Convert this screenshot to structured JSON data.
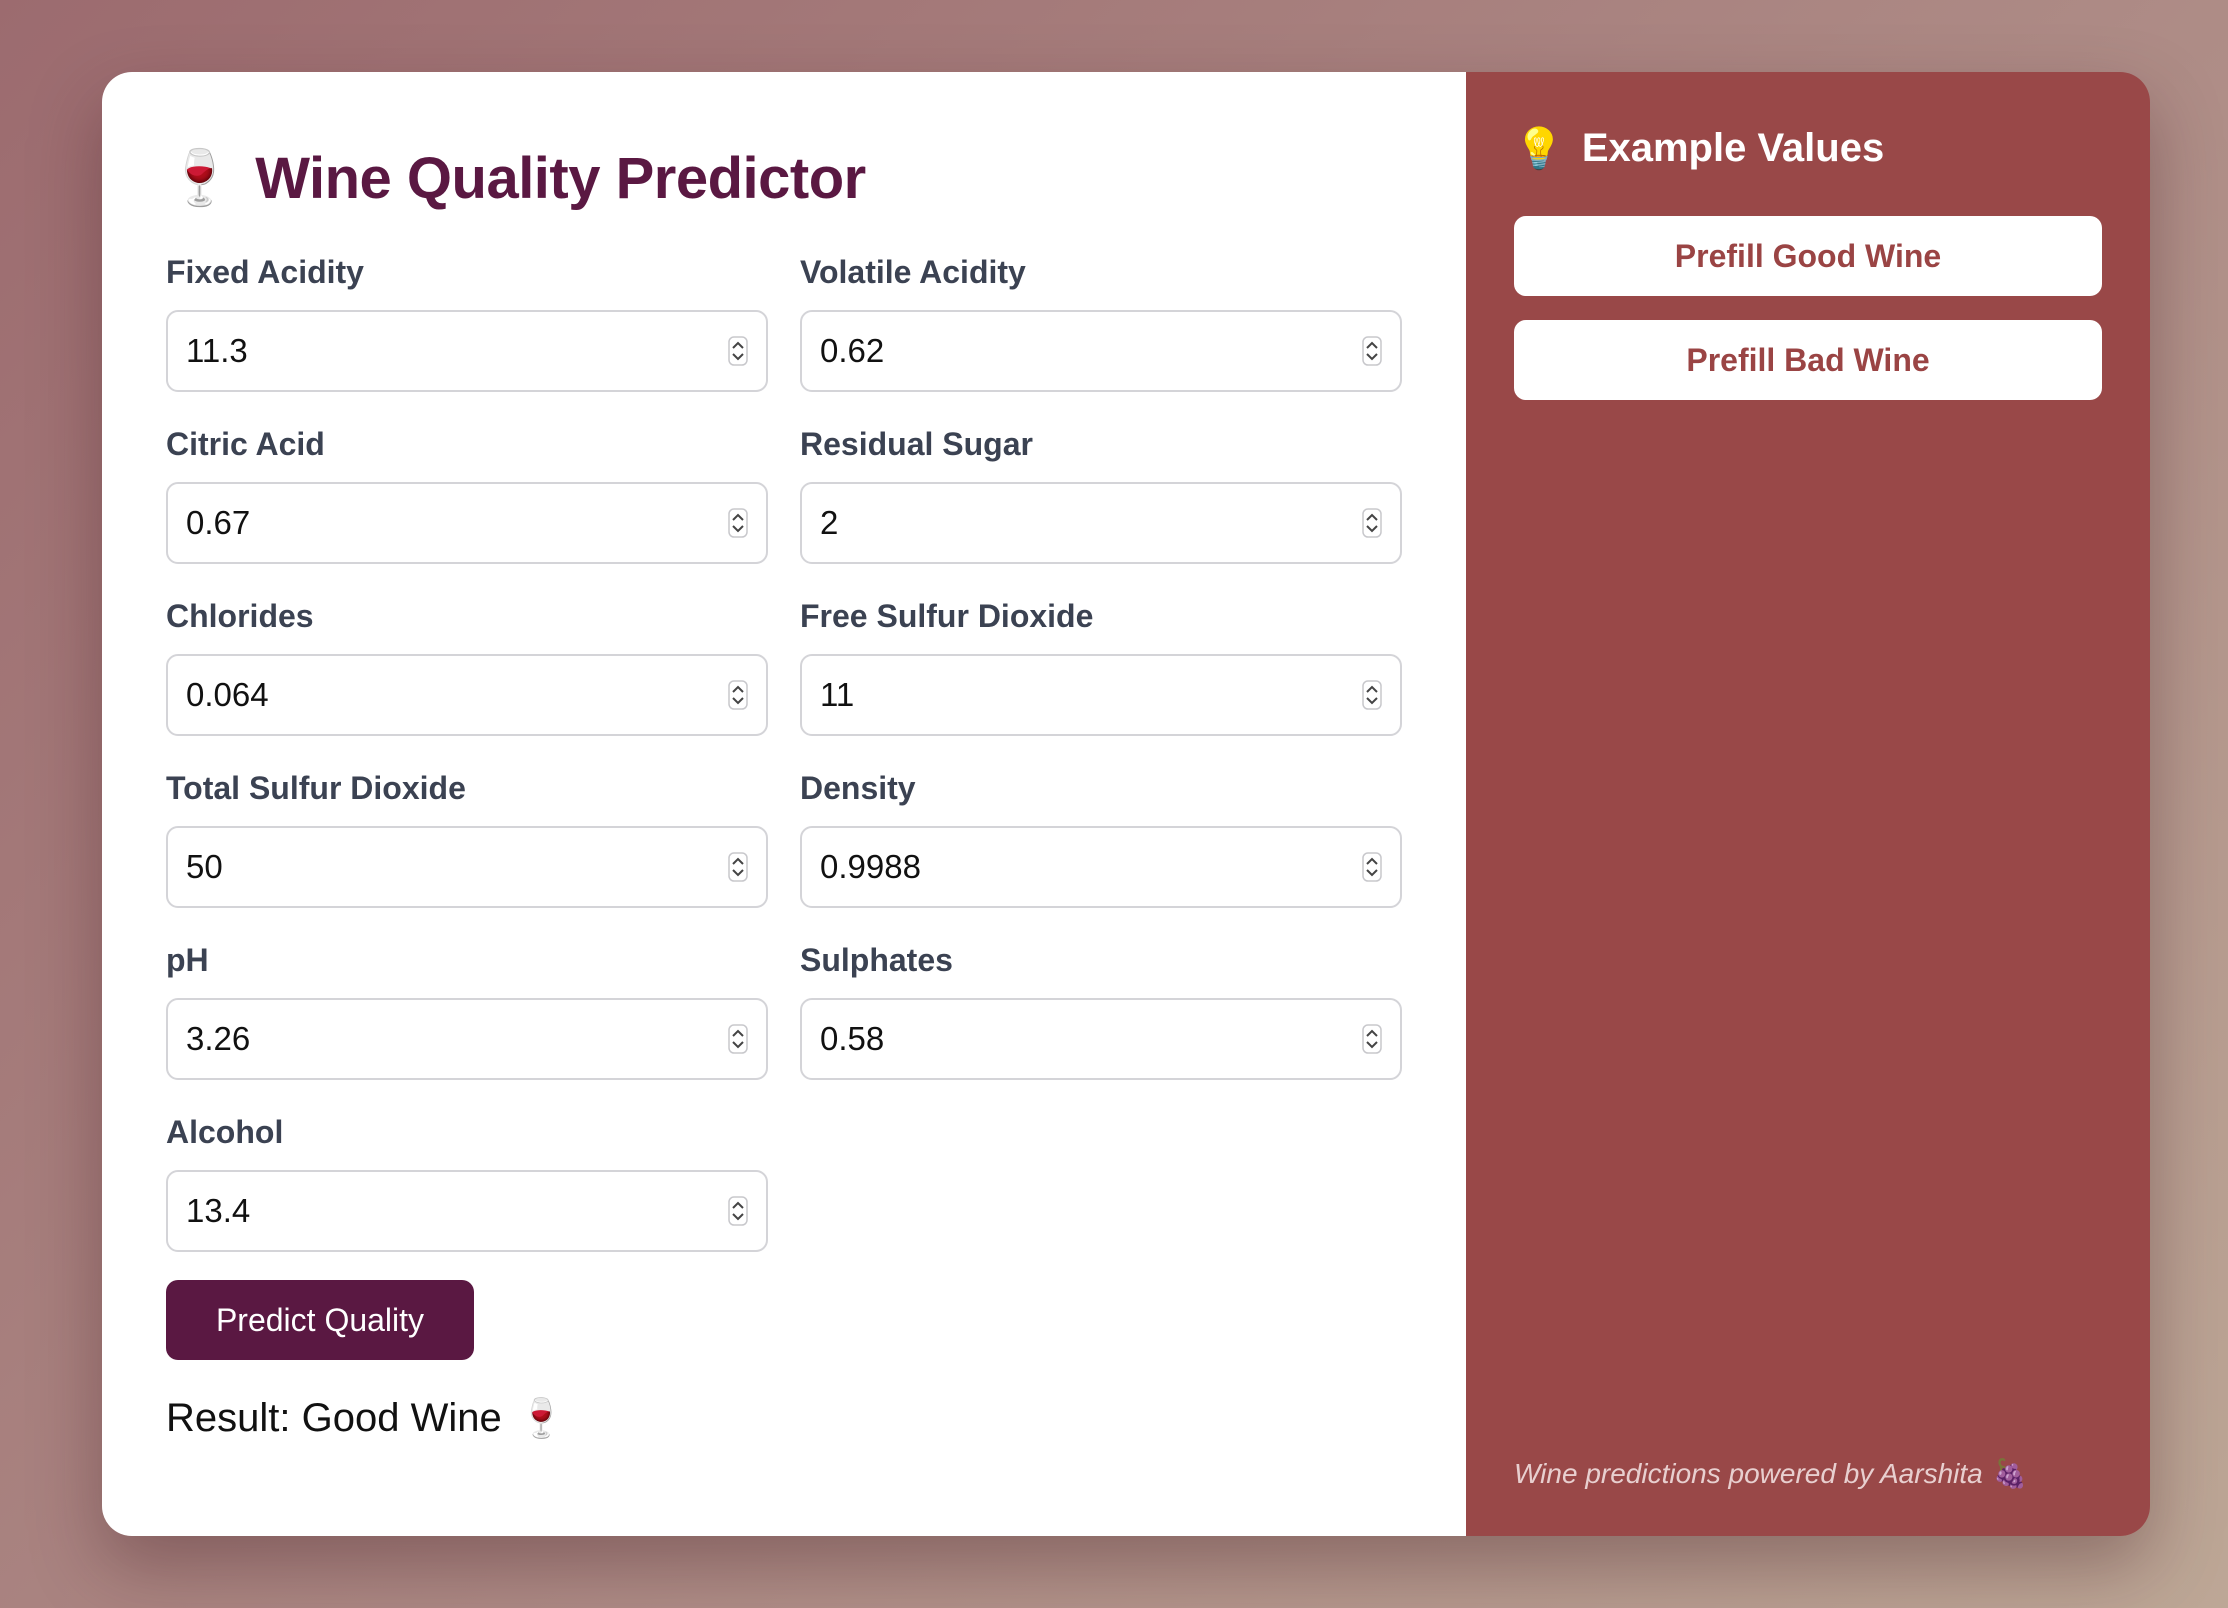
{
  "app": {
    "title": "Wine Quality Predictor",
    "title_icon": "🍷"
  },
  "form": {
    "fields": [
      {
        "label": "Fixed Acidity",
        "value": "11.3"
      },
      {
        "label": "Volatile Acidity",
        "value": "0.62"
      },
      {
        "label": "Citric Acid",
        "value": "0.67"
      },
      {
        "label": "Residual Sugar",
        "value": "2"
      },
      {
        "label": "Chlorides",
        "value": "0.064"
      },
      {
        "label": "Free Sulfur Dioxide",
        "value": "11"
      },
      {
        "label": "Total Sulfur Dioxide",
        "value": "50"
      },
      {
        "label": "Density",
        "value": "0.9988"
      },
      {
        "label": "pH",
        "value": "3.26"
      },
      {
        "label": "Sulphates",
        "value": "0.58"
      },
      {
        "label": "Alcohol",
        "value": "13.4"
      }
    ],
    "submit_label": "Predict Quality",
    "result_text": "Result: Good Wine",
    "result_icon": "🍷"
  },
  "sidebar": {
    "title": "Example Values",
    "title_icon": "💡",
    "buttons": [
      {
        "label": "Prefill Good Wine"
      },
      {
        "label": "Prefill Bad Wine"
      }
    ],
    "footer": "Wine predictions powered by Aarshita",
    "footer_icon": "🍇"
  },
  "colors": {
    "primary": "#5a1842",
    "sidebar_bg": "#994848",
    "button_text": "#9a4444"
  }
}
